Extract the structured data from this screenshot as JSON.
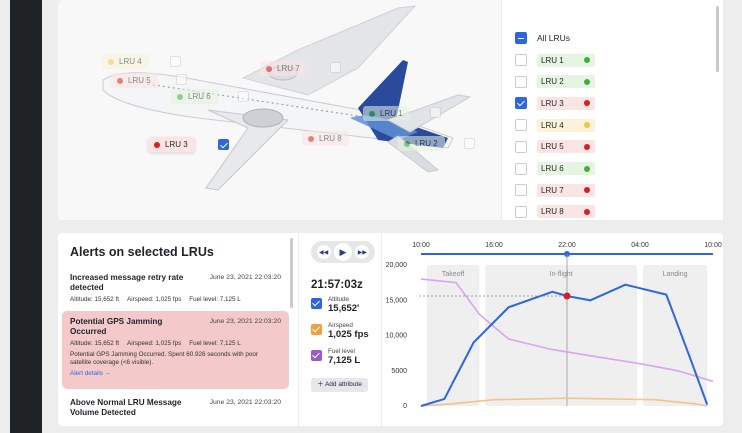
{
  "plane_labels": [
    {
      "id": "lru4",
      "label": "LRU 4",
      "color": "#f0c64a"
    },
    {
      "id": "lru5",
      "label": "LRU 5",
      "color": "#d42020"
    },
    {
      "id": "lru6",
      "label": "LRU 6",
      "color": "#3fae3f"
    },
    {
      "id": "lru7",
      "label": "LRU 7",
      "color": "#d42020"
    },
    {
      "id": "lru1",
      "label": "LRU 1",
      "color": "#3fae3f"
    },
    {
      "id": "lru8",
      "label": "LRU 8",
      "color": "#d42020"
    },
    {
      "id": "lru2",
      "label": "LRU 2",
      "color": "#3fae3f"
    },
    {
      "id": "lru3",
      "label": "LRU 3",
      "color": "#d42020"
    }
  ],
  "lru_list": {
    "all_label": "All LRUs",
    "items": [
      {
        "label": "LRU 1",
        "status": "g",
        "checked": false
      },
      {
        "label": "LRU 2",
        "status": "g",
        "checked": false
      },
      {
        "label": "LRU 3",
        "status": "r",
        "checked": true
      },
      {
        "label": "LRU 4",
        "status": "y",
        "checked": false
      },
      {
        "label": "LRU 5",
        "status": "r",
        "checked": false
      },
      {
        "label": "LRU 6",
        "status": "g",
        "checked": false
      },
      {
        "label": "LRU 7",
        "status": "r",
        "checked": false
      },
      {
        "label": "LRU 8",
        "status": "r",
        "checked": false
      }
    ],
    "status_colors": {
      "g": "#3fae3f",
      "r": "#d42020",
      "y": "#f0c64a"
    }
  },
  "alerts": {
    "title": "Alerts on selected LRUs",
    "items": [
      {
        "title": "Increased message retry rate detected",
        "date": "June 23, 2021 22:03:20",
        "altitude": "Altitude: 15,652 ft",
        "airspeed": "Airspeed: 1,025 fps",
        "fuel": "Fuel level: 7,125 L"
      },
      {
        "title": "Potential GPS Jamming Occurred",
        "date": "June 23, 2021 22:03:20",
        "altitude": "Altitude: 15,652 ft",
        "airspeed": "Airspeed: 1,025 fps",
        "fuel": "Fuel level: 7,125 L",
        "detail": "Potential GPS Jamming Occurred. Spent 60.926 seconds with poor satellite coverage (<6 visible).",
        "link": "Alert details →"
      },
      {
        "title": "Above Normal LRU Message Volume Detected",
        "date": "June 23, 2021 22:03:20"
      }
    ]
  },
  "playback": {
    "time": "21:57:03z",
    "attributes": [
      {
        "label": "Altitude",
        "value": "15,652'",
        "color": "#2d66e0"
      },
      {
        "label": "Airspeed",
        "value": "1,025 fps",
        "color": "#f0a040"
      },
      {
        "label": "Fuel level",
        "value": "7,125 L",
        "color": "#9b59d0"
      }
    ],
    "add_label": "Add attribute"
  },
  "chart_data": {
    "type": "line",
    "time_ticks": [
      "10:00",
      "16:00",
      "22:00",
      "04:00",
      "10:00"
    ],
    "y_ticks": [
      "20,000",
      "15,000",
      "10,000",
      "5000",
      "0"
    ],
    "ylim": [
      0,
      20000
    ],
    "phases": [
      "Takeoff",
      "In-flight",
      "Landing"
    ],
    "cursor_x": 0.5,
    "series": [
      {
        "name": "Altitude",
        "color": "#2d66e0",
        "values": [
          [
            0,
            0
          ],
          [
            0.08,
            1000
          ],
          [
            0.18,
            9000
          ],
          [
            0.3,
            14000
          ],
          [
            0.45,
            16200
          ],
          [
            0.5,
            15600
          ],
          [
            0.58,
            15000
          ],
          [
            0.7,
            17200
          ],
          [
            0.84,
            15800
          ],
          [
            0.92,
            7000
          ],
          [
            0.98,
            200
          ]
        ]
      },
      {
        "name": "Fuel level",
        "color": "#d6a6ef",
        "values": [
          [
            0,
            18000
          ],
          [
            0.12,
            17500
          ],
          [
            0.2,
            13000
          ],
          [
            0.3,
            9500
          ],
          [
            0.45,
            8000
          ],
          [
            0.6,
            7000
          ],
          [
            0.75,
            6000
          ],
          [
            0.88,
            5000
          ],
          [
            1.0,
            3500
          ]
        ]
      },
      {
        "name": "Airspeed",
        "color": "#f6c28a",
        "values": [
          [
            0,
            0
          ],
          [
            0.1,
            300
          ],
          [
            0.25,
            900
          ],
          [
            0.5,
            1100
          ],
          [
            0.8,
            900
          ],
          [
            0.94,
            300
          ],
          [
            0.98,
            0
          ]
        ]
      }
    ]
  }
}
